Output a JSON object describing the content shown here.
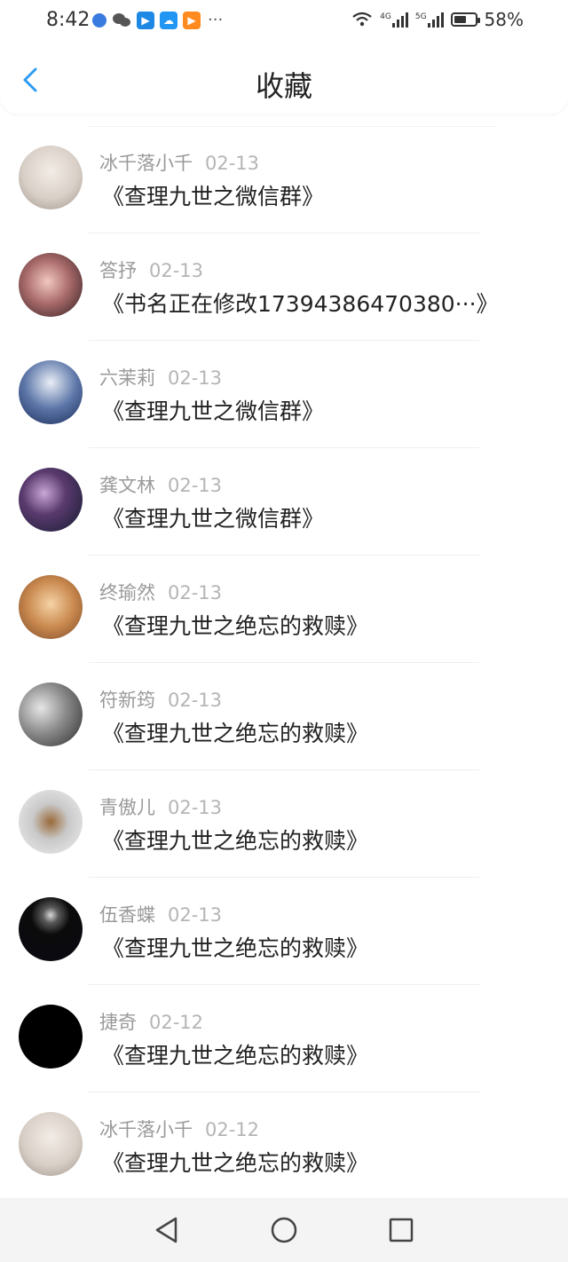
{
  "status_bar": {
    "time": "8:42",
    "battery_percent": "58%",
    "network_1": "4G",
    "network_2": "5G",
    "battery_level": 0.58
  },
  "header": {
    "title": "收藏",
    "back_icon": "chevron-left-icon",
    "accent": "#2f9bf0"
  },
  "items": [
    {
      "user": "冰千落小千",
      "date": "02-13",
      "title": "《查理九世之微信群》"
    },
    {
      "user": "答抒",
      "date": "02-13",
      "title": "《书名正在修改17394386470380···》"
    },
    {
      "user": "六茉莉",
      "date": "02-13",
      "title": "《查理九世之微信群》"
    },
    {
      "user": "龚文林",
      "date": "02-13",
      "title": "《查理九世之微信群》"
    },
    {
      "user": "终瑜然",
      "date": "02-13",
      "title": "《查理九世之绝忘的救赎》"
    },
    {
      "user": "符新筠",
      "date": "02-13",
      "title": "《查理九世之绝忘的救赎》"
    },
    {
      "user": "青傲儿",
      "date": "02-13",
      "title": "《查理九世之绝忘的救赎》"
    },
    {
      "user": "伍香蝶",
      "date": "02-13",
      "title": "《查理九世之绝忘的救赎》"
    },
    {
      "user": "捷奇",
      "date": "02-12",
      "title": "《查理九世之绝忘的救赎》"
    },
    {
      "user": "冰千落小千",
      "date": "02-12",
      "title": "《查理九世之绝忘的救赎》"
    }
  ],
  "navbar": {
    "back": "triangle-back-icon",
    "home": "circle-home-icon",
    "recents": "square-recents-icon"
  }
}
